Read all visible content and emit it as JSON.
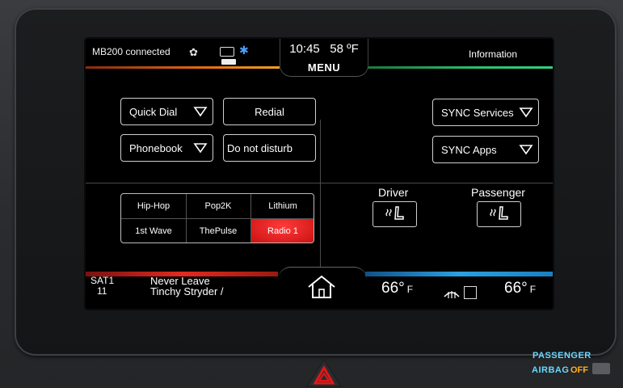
{
  "status": {
    "phone_text": "MB200 connected",
    "time": "10:45",
    "outside_temp": "58 ºF",
    "menu_label": "MENU",
    "info_label": "Information"
  },
  "phone": {
    "quick_dial": "Quick Dial",
    "redial": "Redial",
    "phonebook": "Phonebook",
    "do_not_disturb": "Do not disturb"
  },
  "sync": {
    "services": "SYNC Services",
    "apps": "SYNC Apps"
  },
  "presets": [
    {
      "label": "Hip-Hop"
    },
    {
      "label": "Pop2K"
    },
    {
      "label": "Lithium"
    },
    {
      "label": "1st Wave"
    },
    {
      "label": "ThePulse"
    },
    {
      "label": "Radio 1",
      "selected": true
    }
  ],
  "climate": {
    "driver_label": "Driver",
    "passenger_label": "Passenger",
    "driver_temp": "66°",
    "passenger_temp": "66°",
    "unit": "F"
  },
  "now_playing": {
    "source": "SAT1",
    "channel": "11",
    "title": "Never Leave",
    "artist": "Tinchy Stryder /"
  },
  "dash": {
    "airbag_line1": "PASSENGER",
    "airbag_line2": "AIRBAG",
    "airbag_state": "OFF"
  },
  "colors": {
    "preset_selected": "#e01a1a",
    "audio_accent": "#e22a20",
    "climate_accent": "#2aa0e0",
    "phone_accent": "#e46a12",
    "info_accent": "#2cc070"
  }
}
